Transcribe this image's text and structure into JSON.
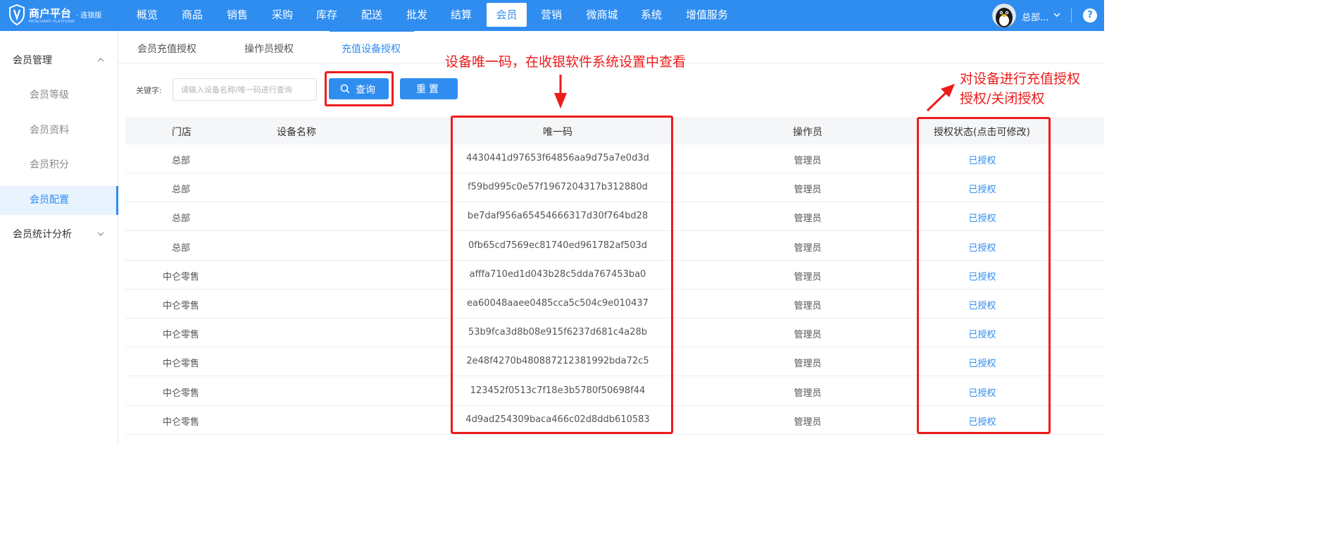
{
  "brand": {
    "title": "商户平台",
    "badge": "· 连锁版",
    "subtitle": "MERCHANT PLATFORM"
  },
  "nav": [
    {
      "label": "概览"
    },
    {
      "label": "商品"
    },
    {
      "label": "销售"
    },
    {
      "label": "采购"
    },
    {
      "label": "库存"
    },
    {
      "label": "配送"
    },
    {
      "label": "批发"
    },
    {
      "label": "结算"
    },
    {
      "label": "会员",
      "active": true
    },
    {
      "label": "营销"
    },
    {
      "label": "微商城"
    },
    {
      "label": "系统"
    },
    {
      "label": "增值服务"
    }
  ],
  "user": {
    "name": "总部...",
    "help": "?"
  },
  "sidebar": {
    "groups": [
      {
        "label": "会员管理",
        "expanded": true
      },
      {
        "label": "会员统计分析",
        "expanded": false
      }
    ],
    "items": [
      {
        "label": "会员等级"
      },
      {
        "label": "会员资料"
      },
      {
        "label": "会员积分"
      },
      {
        "label": "会员配置",
        "active": true
      }
    ]
  },
  "tabs": [
    {
      "label": "会员充值授权"
    },
    {
      "label": "操作员授权"
    },
    {
      "label": "充值设备授权",
      "active": true
    }
  ],
  "search": {
    "label": "关键字:",
    "placeholder": "请输入设备名称/唯一码进行查询",
    "value": "",
    "search_button": "查询",
    "reset_button": "重置"
  },
  "table": {
    "columns": [
      "门店",
      "设备名称",
      "唯一码",
      "操作员",
      "授权状态(点击可修改)"
    ],
    "rows": [
      {
        "store": "总部",
        "device": "",
        "code": "4430441d97653f64856aa9d75a7e0d3d",
        "operator": "管理员",
        "status": "已授权"
      },
      {
        "store": "总部",
        "device": "",
        "code": "f59bd995c0e57f1967204317b312880d",
        "operator": "管理员",
        "status": "已授权"
      },
      {
        "store": "总部",
        "device": "",
        "code": "be7daf956a65454666317d30f764bd28",
        "operator": "管理员",
        "status": "已授权"
      },
      {
        "store": "总部",
        "device": "",
        "code": "0fb65cd7569ec81740ed961782af503d",
        "operator": "管理员",
        "status": "已授权"
      },
      {
        "store": "中仑零售",
        "device": "",
        "code": "afffa710ed1d043b28c5dda767453ba0",
        "operator": "管理员",
        "status": "已授权"
      },
      {
        "store": "中仑零售",
        "device": "",
        "code": "ea60048aaee0485cca5c504c9e010437",
        "operator": "管理员",
        "status": "已授权"
      },
      {
        "store": "中仑零售",
        "device": "",
        "code": "53b9fca3d8b08e915f6237d681c4a28b",
        "operator": "管理员",
        "status": "已授权"
      },
      {
        "store": "中仑零售",
        "device": "",
        "code": "2e48f4270b480887212381992bda72c5",
        "operator": "管理员",
        "status": "已授权"
      },
      {
        "store": "中仑零售",
        "device": "",
        "code": "123452f0513c7f18e3b5780f50698f44",
        "operator": "管理员",
        "status": "已授权"
      },
      {
        "store": "中仑零售",
        "device": "",
        "code": "4d9ad254309baca466c02d8ddb610583",
        "operator": "管理员",
        "status": "已授权"
      }
    ]
  },
  "annotations": {
    "code_note": "设备唯一码，在收银软件系统设置中查看",
    "auth_note_line1": "对设备进行充值授权",
    "auth_note_line2": "授权/关闭授权"
  },
  "colors": {
    "primary": "#2f8df0",
    "annotation": "#ee1b1b"
  }
}
